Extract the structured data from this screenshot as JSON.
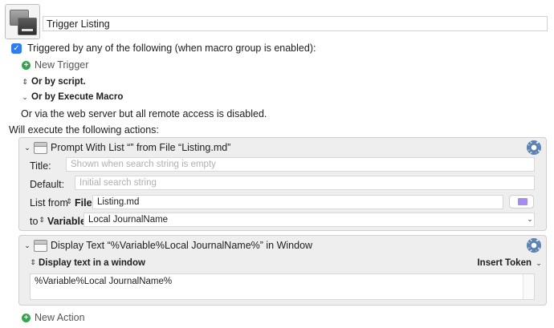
{
  "macro": {
    "name": "Trigger Listing"
  },
  "triggers": {
    "checkbox_checked": true,
    "checkbox_glyph": "✓",
    "triggered_label": "Triggered by any of the following (when macro group is enabled):",
    "new_trigger_label": "New Trigger",
    "or_by_script_label": "Or by script.",
    "or_by_execute_macro_label": "Or by Execute Macro",
    "web_server_text": "Or via the web server but all remote access is disabled."
  },
  "actions_header": "Will execute the following actions:",
  "actions": [
    {
      "title": "Prompt With List “” from File “Listing.md”",
      "title_label": "Title:",
      "title_placeholder": "Shown when search string is empty",
      "default_label": "Default:",
      "default_placeholder": "Initial search string",
      "list_from_label": "List from",
      "list_from_type": "File",
      "list_from_value": "Listing.md",
      "to_label": "to",
      "to_type": "Variable",
      "to_value": "Local JournalName"
    },
    {
      "title": "Display Text “%Variable%Local JournalName%” in Window",
      "display_mode": "Display text in a window",
      "insert_token_label": "Insert Token",
      "text_value": "%Variable%Local JournalName%"
    }
  ],
  "new_action_label": "New Action",
  "glyphs": {
    "plus": "+",
    "updown": "⇕",
    "chevron_down": "⌄",
    "disclosure_open": "⌄"
  },
  "colors": {
    "checkbox": "#2f7cf6",
    "add_green": "#2ea94a",
    "gear_blue": "#5b82b5",
    "folder_purple": "#a58cf0"
  }
}
